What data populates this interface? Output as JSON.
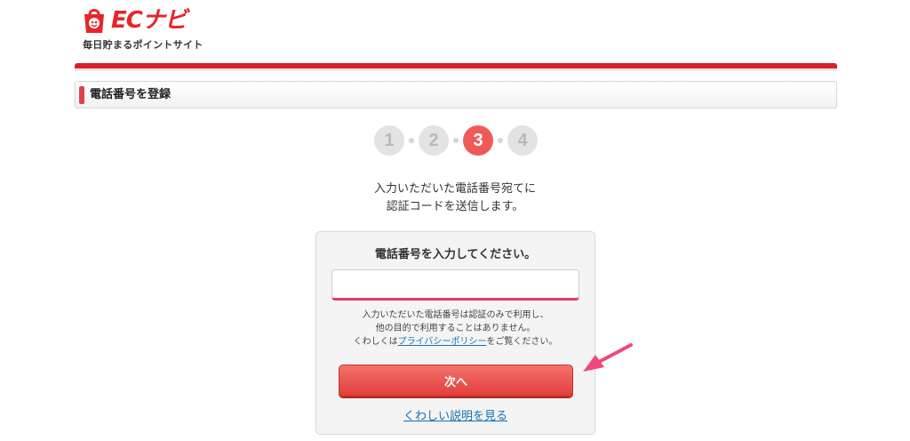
{
  "header": {
    "logo_text": "ECナビ",
    "tagline": "毎日貯まるポイントサイト"
  },
  "section": {
    "title": "電話番号を登録"
  },
  "steps": {
    "items": [
      "1",
      "2",
      "3",
      "4"
    ],
    "current": 3
  },
  "lead": {
    "line1": "入力いただいた電話番号宛てに",
    "line2": "認証コードを送信します。"
  },
  "form": {
    "title": "電話番号を入力してください。",
    "phone_value": "",
    "note_line1": "入力いただいた電話番号は認証のみで利用し、",
    "note_line2": "他の目的で利用することはありません。",
    "note_line3_prefix": "くわしくは",
    "privacy_link": "プライバシーポリシー",
    "note_line3_suffix": "をご覧ください。",
    "next_label": "次へ",
    "more_link": "くわしい説明を見る"
  },
  "colors": {
    "brand": "#e8242b",
    "accent": "#ef5a58",
    "link": "#1a6fb5",
    "pointer": "#ef4a7a"
  },
  "icons": {
    "logo": "bag-logo-icon",
    "pointer": "pointer-arrow-icon"
  }
}
